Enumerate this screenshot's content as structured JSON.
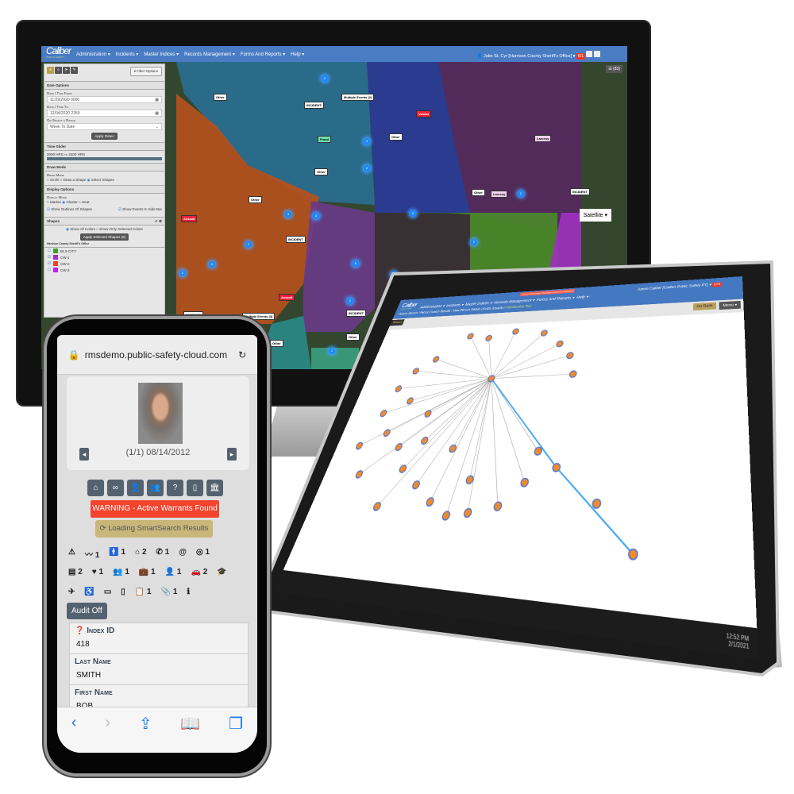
{
  "monitor": {
    "app": {
      "logo": "Caliber",
      "logo_sub": "PUBLIC SAFETY"
    },
    "nav": [
      "Administration ▾",
      "Incidents ▾",
      "Master Indices ▾",
      "Records Management ▾",
      "Forms And Reports ▾",
      "Help ▾"
    ],
    "user": "Jake St. Cyr [Harrison County Sheriff's Office]",
    "alert_badge": "6/1",
    "layers_button": "☰ (83)",
    "sidebar": {
      "filter_options": "▾ Filter Options",
      "date_options": "Date Options",
      "date_from_label": "Date / Time From",
      "date_from": "11/29/2020 0000",
      "date_to_label": "Date / Time To",
      "date_to": "12/04/2020 2359",
      "range_label": "Or Select a Range",
      "range_value": "Week To Date",
      "apply_dates": "Apply Dates",
      "time_slider": "Time Slider",
      "time_range": "0000 HRS to 2400 HRS",
      "draw_mode": "Draw Mode",
      "draw_mode_label": "Draw Mode",
      "draw_options": [
        "Circle",
        "Draw a Shape",
        "Select Shapes"
      ],
      "display_options": "Display Options",
      "display_mode_label": "Display Mode",
      "display_modes": [
        "Marker",
        "Cluster",
        "Heat"
      ],
      "show_outlines": "Show Outlines Of Shapes",
      "show_events": "Show Events In Side Bar",
      "shapes": "Shapes",
      "show_all_colors": "Show All Colors",
      "show_selected_colors": "Show Only Selected Colors",
      "apply_shapes": "Apply Selected Shapes (8)",
      "agency": "Harrison County Sheriff's Office",
      "shape_items": [
        {
          "name": "BLX-CITY",
          "color": "#3aa02a",
          "checked": false
        },
        {
          "name": "CW-1",
          "color": "#a030c0",
          "checked": true
        },
        {
          "name": "CW-2",
          "color": "#f04020",
          "checked": true
        },
        {
          "name": "CW-3",
          "color": "#c020f0",
          "checked": false
        }
      ]
    },
    "map_labels": [
      "Other",
      "INCIDENT",
      "Multiple Events (2)",
      "Vandal",
      "Fraud",
      "Other",
      "Larceny",
      "Other",
      "Other",
      "Other",
      "Larceny",
      "INCIDENT",
      "Assault",
      "INCIDENT",
      "Assault",
      "INCIDENT",
      "Multiple Events (3)",
      "INCIDENT",
      "Other",
      "Other"
    ],
    "clusters": [
      "2",
      "4",
      "2",
      "3",
      "3",
      "2",
      "3",
      "6",
      "2",
      "2",
      "2",
      "4",
      "2",
      "2",
      "2"
    ],
    "satellite_button": "Satellite ▾"
  },
  "tablet": {
    "logo": "Caliber",
    "logo_sub": "PUBLIC SAFETY",
    "nav": [
      "Administration ▾",
      "Incidents ▾",
      "Master Indices ▾",
      "Records Management ▾",
      "Forms And Reports ▾",
      "Help ▾"
    ],
    "warning": "You are accessing a Training or Demo Environment",
    "user": "Admin Caliber [Caliber Public Safety PT]",
    "alert_badge": "37/3",
    "breadcrumb": [
      "Person Search /",
      "Person Search Results /",
      "View Person Details (Smith,Joseph) /"
    ],
    "breadcrumb_current": "Visualization Tool",
    "network_tab": "Network",
    "go_back": "Go Back",
    "menu": "Menu ▾",
    "clock_time": "12:52 PM",
    "clock_date": "2/1/2021"
  },
  "phone": {
    "url": "rmsdemo.public-safety-cloud.com",
    "photo_caption": "(1/1) 08/14/2012",
    "action_icons": [
      "map-icon",
      "link-icon",
      "person-icon",
      "group-icon",
      "question-icon",
      "document-icon",
      "building-icon"
    ],
    "warning": "WARNING - Active Warrants Found",
    "loading": "⟳ Loading SmartSearch Results",
    "icon_rows": [
      [
        [
          "⚠",
          ""
        ],
        [
          "〰",
          "1"
        ],
        [
          "🚹",
          "1"
        ],
        [
          "⌂",
          "2"
        ],
        [
          "✆",
          "1"
        ],
        [
          "@",
          ""
        ],
        [
          "◎",
          "1"
        ]
      ],
      [
        [
          "▤",
          "2"
        ],
        [
          "♥",
          "1"
        ],
        [
          "👥",
          "1"
        ],
        [
          "💼",
          "1"
        ],
        [
          "👤",
          "1"
        ],
        [
          "🚗",
          "2"
        ],
        [
          "🎓",
          ""
        ]
      ],
      [
        [
          "✈",
          ""
        ],
        [
          "♿",
          ""
        ],
        [
          "▭",
          ""
        ],
        [
          "▯",
          ""
        ],
        [
          "📋",
          "1"
        ],
        [
          "📎",
          "1"
        ],
        [
          "ℹ",
          ""
        ]
      ]
    ],
    "audit_button": "Audit Off",
    "fields": [
      {
        "label": "Index ID",
        "value": "418"
      },
      {
        "label": "Last Name",
        "value": "SMITH"
      },
      {
        "label": "First Name",
        "value": "BOB"
      }
    ]
  }
}
